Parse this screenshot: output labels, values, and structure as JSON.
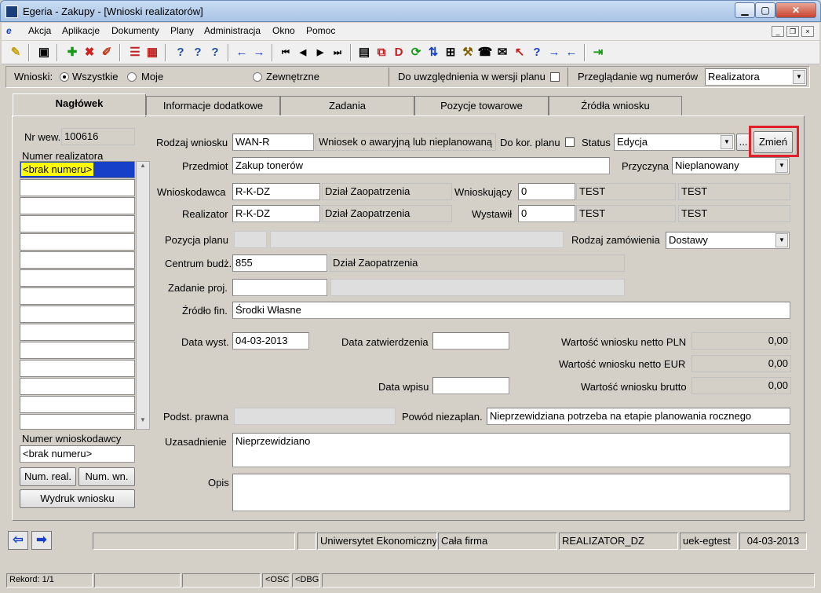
{
  "window": {
    "title": "Egeria - Zakupy - [Wnioski realizatorów]",
    "min": "▁",
    "max": "▢",
    "close": "✕"
  },
  "menu": [
    "Akcja",
    "Aplikacje",
    "Dokumenty",
    "Plany",
    "Administracja",
    "Okno",
    "Pomoc"
  ],
  "filter": {
    "label": "Wnioski:",
    "opt1": "Wszystkie",
    "opt2": "Moje",
    "opt3": "Zewnętrzne",
    "plan_label": "Do uwzględnienia w wersji planu",
    "browse_label": "Przeglądanie wg numerów",
    "browse_value": "Realizatora"
  },
  "tabs": [
    "Nagłówek",
    "Informacje dodatkowe",
    "Zadania",
    "Pozycje towarowe",
    "Źródła wniosku"
  ],
  "left": {
    "nr_wew_label": "Nr wew.",
    "nr_wew": "100616",
    "numer_real_label": "Numer realizatora",
    "first_item": "<brak numeru>",
    "numer_wn_label": "Numer wnioskodawcy",
    "numer_wn": "<brak numeru>",
    "btn_real": "Num. real.",
    "btn_wn": "Num. wn.",
    "btn_print": "Wydruk wniosku"
  },
  "form": {
    "rodzaj_label": "Rodzaj wniosku",
    "rodzaj_code": "WAN-R",
    "rodzaj_desc": "Wniosek o awaryjną lub nieplanowaną",
    "dokor_label": "Do kor. planu",
    "status_label": "Status",
    "status": "Edycja",
    "dots": "...",
    "zmien": "Zmień",
    "przedmiot_label": "Przedmiot",
    "przedmiot": "Zakup tonerów",
    "przyczyna_label": "Przyczyna",
    "przyczyna": "Nieplanowany",
    "wnioskodawca_label": "Wnioskodawca",
    "wnioskodawca_code": "R-K-DZ",
    "wnioskodawca_name": "Dział Zaopatrzenia",
    "wnioskujacy_label": "Wnioskujący",
    "wnioskujacy_id": "0",
    "wnioskujacy_a": "TEST",
    "wnioskujacy_b": "TEST",
    "realizator_label": "Realizator",
    "realizator_code": "R-K-DZ",
    "realizator_name": "Dział Zaopatrzenia",
    "wystawil_label": "Wystawił",
    "wystawil_id": "0",
    "wystawil_a": "TEST",
    "wystawil_b": "TEST",
    "pozycja_label": "Pozycja planu",
    "rodzaj_zam_label": "Rodzaj zamówienia",
    "rodzaj_zam": "Dostawy",
    "centrum_label": "Centrum budż.",
    "centrum_code": "855",
    "centrum_name": "Dział Zaopatrzenia",
    "zadanie_label": "Zadanie proj.",
    "zrodlo_label": "Źródło fin.",
    "zrodlo": "Środki Własne",
    "data_wyst_label": "Data wyst.",
    "data_wyst": "04-03-2013",
    "data_zatw_label": "Data zatwierdzenia",
    "netto_pln_label": "Wartość wniosku netto PLN",
    "netto_pln": "0,00",
    "netto_eur_label": "Wartość wniosku netto EUR",
    "netto_eur": "0,00",
    "data_wpisu_label": "Data wpisu",
    "brutto_label": "Wartość wniosku brutto",
    "brutto": "0,00",
    "podst_label": "Podst. prawna",
    "powod_label": "Powód niezaplan.",
    "powod": "Nieprzewidziana potrzeba na etapie planowania rocznego",
    "uzasadnienie_label": "Uzasadnienie",
    "uzasadnienie": "Nieprzewidziano",
    "opis_label": "Opis"
  },
  "status": {
    "uni": "Uniwersytet Ekonomiczny",
    "firma": "Cała firma",
    "user": "REALIZATOR_DZ",
    "db": "uek-egtest",
    "date": "04-03-2013",
    "rekord": "Rekord: 1/1",
    "osc": "<OSC>",
    "dbg": "<DBG>"
  },
  "colors": {
    "highlight": "#ffff00",
    "annotation": "#e0202a",
    "selection": "#1740c8"
  }
}
